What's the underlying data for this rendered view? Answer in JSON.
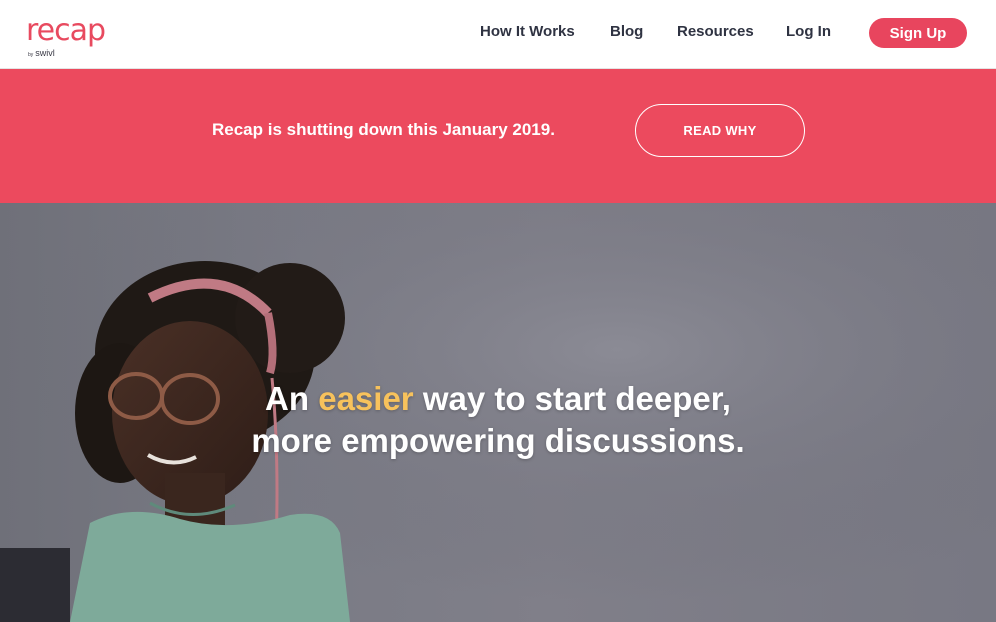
{
  "brand": {
    "logo_word": "recap",
    "logo_by": "by",
    "logo_sub": "swivl",
    "color": "#e84a5f"
  },
  "nav": {
    "items": [
      {
        "label": "How It Works"
      },
      {
        "label": "Blog"
      },
      {
        "label": "Resources"
      },
      {
        "label": "Log In"
      }
    ],
    "signup_label": "Sign Up"
  },
  "banner": {
    "message": "Recap is shutting down this January 2019.",
    "cta_label": "READ WHY",
    "background": "#ec4a5e"
  },
  "hero": {
    "headline_pre": "An ",
    "headline_accent": "easier",
    "headline_post": " way to start deeper,",
    "headline_line2": "more empowering discussions.",
    "accent_color": "#f7c25c"
  }
}
